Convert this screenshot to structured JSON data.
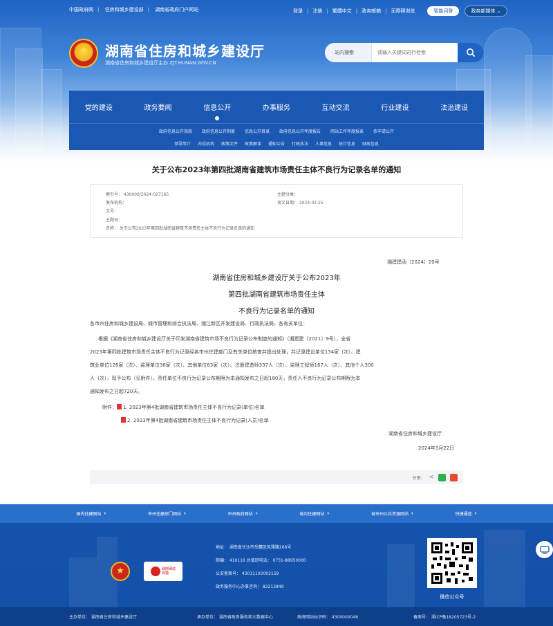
{
  "topbar": {
    "left_links": [
      "中国政府网",
      "住房和城乡建设部",
      "湖南省政府门户网站"
    ],
    "right_links": [
      "登录",
      "注册",
      "繁體中文",
      "政务邮箱",
      "无障碍浏览"
    ],
    "pill_button": "智能问答",
    "dropdown_button": "政务新媒体"
  },
  "header": {
    "site_title": "湖南省住房和城乡建设厅",
    "site_subtitle": "湖南省住房和城乡建设厅主办  ZJT.HUNAN.GOV.CN"
  },
  "search": {
    "scope": "站内搜索",
    "placeholder": "请输入关键词进行检索"
  },
  "nav": {
    "main": [
      "党的建设",
      "政务要闻",
      "信息公开",
      "办事服务",
      "互动交流",
      "行业建设",
      "法治建设"
    ],
    "active_index": 2,
    "sub1": [
      "政府信息公开指南",
      "政府信息公开制度",
      "信息公开目录",
      "政府信息公开年度报告",
      "网站工作年度报表",
      "依申请公开"
    ],
    "sub2": [
      "领导简介",
      "内设机构",
      "政策文件",
      "政策解读",
      "通知公告",
      "行政执法",
      "人事信息",
      "统计信息",
      "财政信息"
    ]
  },
  "article": {
    "title": "关于公布2023年第四批湖南省建筑市场责任主体不良行为记录名单的通知",
    "meta": {
      "index_no": "索引号：  430000/2024-027165",
      "publish_org": "发布机构：",
      "subject_category": "主题分类：",
      "subject_words": "主题词：",
      "name": "名称：  关于公布2023年第四批湖南省建筑市场责任主体不良行为记录名单的通知",
      "doc_no": "文号：",
      "date": "发文日期：  2024-03-25"
    },
    "doc_number": "湘建建函〔2024〕20号",
    "doc_title_lines": [
      "湖南省住房和城乡建设厅关于公布2023年",
      "第四批湖南省建筑市场责任主体",
      "不良行为记录名单的通知"
    ],
    "salutation": "各市州住房和城乡建设局、城市管理和综合执法局、湘江新区开发建设局、行政执法局，各有关单位：",
    "body_lines": [
      "根据《湖南省住房和城乡建设厅关于印发湖南省建筑市场不良行为记录公布制度的通知》（湘建建〔2021〕9号），全省",
      "2023年第四批建筑市场责任主体不良行为记录经各市州住建部门及有关单位核查并提出处理，共记录建设单位134家（次）、建",
      "筑业单位126家（次）、监理单位38家（次）、其他单位63家（次）、注册建造师337人（次）、监理工程师167人（次）、其他个人300",
      "人（次），现予公布（见附件）。责任单位不良行为记录公布期限为本通知发布之日起180天，责任人不良行为记录公布期限为本",
      "通知发布之日起720天。"
    ],
    "attachments_label": "附件：",
    "attachments": [
      "1. 2023年第4批湖南省建筑市场责任主体不良行为记录(单位)名单",
      "2. 2023年第4批湖南省建筑市场责任主体不良行为记录(人员)名单"
    ],
    "signature_org": "湖南省住房和城乡建设厅",
    "signature_date": "2024年3月22日",
    "share_label": "分享："
  },
  "friend_links": [
    "国内住建网站",
    "市州住建部门网站",
    "市州政府网站",
    "省内住建网站",
    "省市州公共资源网站",
    "快捷通道"
  ],
  "footer": {
    "badge_line1": "政府网站",
    "badge_line2": "找错",
    "address": "地址：  湖南省长沙市岳麓区风雅路266号",
    "postcode": "邮编：  410116    总值班电话：  0731-88950000",
    "police_no": "公安备案号：  43011102002159",
    "service_phone": "政务服务中心办事咨询：  82213849",
    "qr_caption": "微信公众号",
    "host": "主办单位：  湖南省住房和城乡建设厅",
    "support": "承办单位：  湖南省政务服务和大数据中心",
    "site_id": "政府网站标识码：  4300000046",
    "icp": "备案号：  湘ICP备18205723号-2"
  },
  "colors": {
    "primary": "#1b58b3",
    "nav": "#1b58b3",
    "footer": "#1250a8",
    "accent_red": "#c8281c"
  }
}
